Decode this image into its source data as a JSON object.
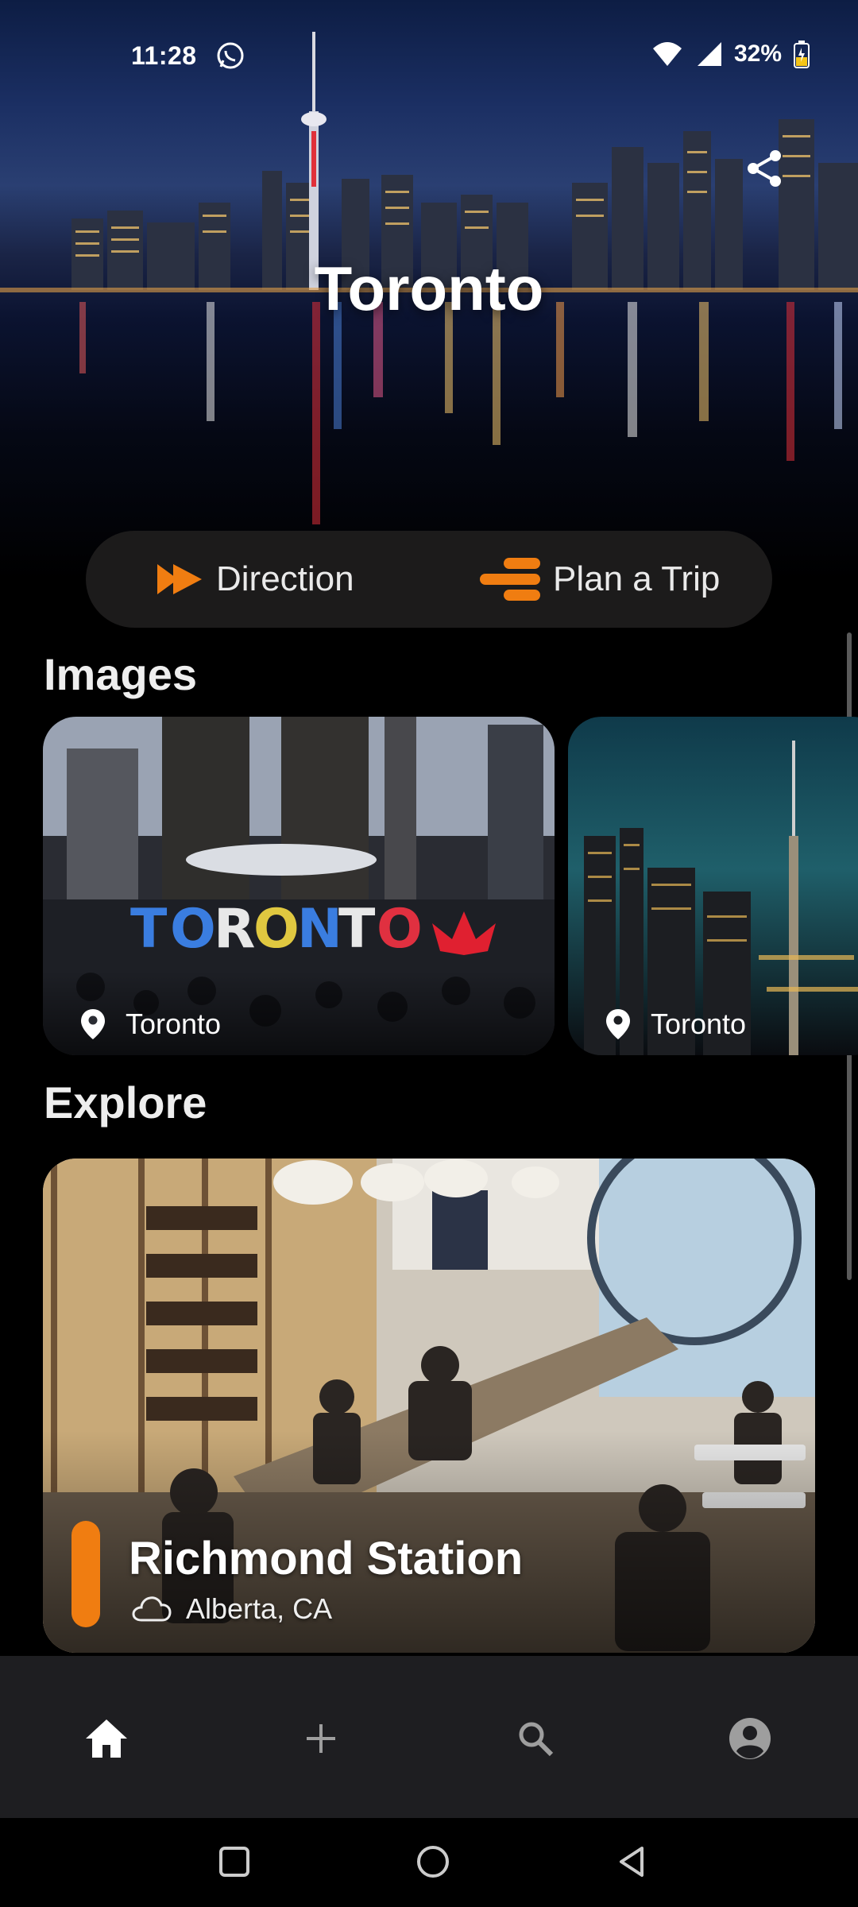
{
  "status_bar": {
    "time": "11:28",
    "battery": "32%",
    "icons": [
      "whatsapp-icon",
      "wifi-icon",
      "signal-icon",
      "battery-icon"
    ]
  },
  "hero": {
    "title": "Toronto",
    "share_icon": "share-icon"
  },
  "actions": {
    "direction_label": "Direction",
    "plan_trip_label": "Plan a Trip",
    "accent_color": "#f07d11"
  },
  "images_section": {
    "title": "Images",
    "cards": [
      {
        "location": "Toronto"
      },
      {
        "location": "Toronto"
      }
    ]
  },
  "explore_section": {
    "title": "Explore",
    "card": {
      "name": "Richmond Station",
      "location": "Alberta, CA",
      "icon": "cloud-icon"
    }
  },
  "bottom_nav": {
    "items": [
      "home-icon",
      "add-icon",
      "search-icon",
      "profile-icon"
    ]
  },
  "system_nav": {
    "items": [
      "recent-apps-icon",
      "home-circle-icon",
      "back-icon"
    ]
  }
}
